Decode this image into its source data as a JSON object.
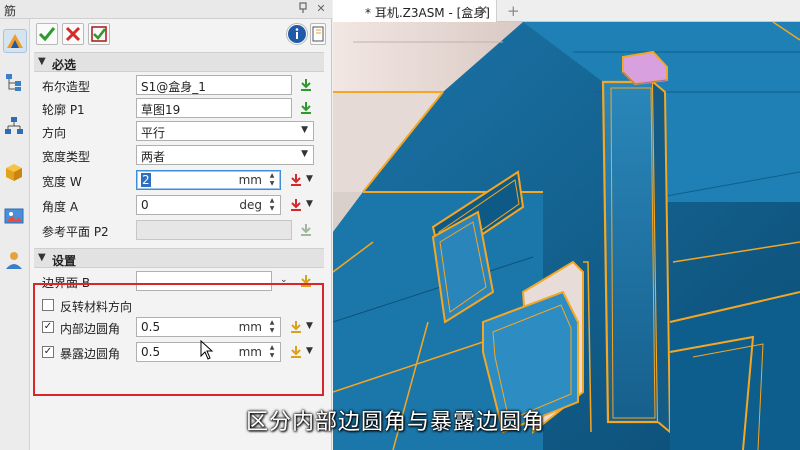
{
  "panel": {
    "title": "筋"
  },
  "sections": {
    "required": "必选",
    "settings": "设置"
  },
  "fields": {
    "boolean_base": {
      "label": "布尔造型",
      "value": "S1@盒身_1"
    },
    "profile": {
      "label": "轮廓 P1",
      "value": "草图19"
    },
    "direction": {
      "label": "方向",
      "value": "平行"
    },
    "width_type": {
      "label": "宽度类型",
      "value": "两者"
    },
    "width": {
      "label": "宽度 W",
      "value": "2",
      "unit": "mm"
    },
    "angle": {
      "label": "角度 A",
      "value": "0",
      "unit": "deg"
    },
    "ref_plane": {
      "label": "参考平面 P2",
      "value": ""
    },
    "boundary": {
      "label": "边界面 B",
      "value": ""
    },
    "reverse_material": {
      "label": "反转材料方向",
      "checked": false
    },
    "inner_fillet": {
      "label": "内部边圆角",
      "checked": true,
      "value": "0.5",
      "unit": "mm"
    },
    "exposed_fillet": {
      "label": "暴露边圆角",
      "checked": true,
      "value": "0.5",
      "unit": "mm"
    }
  },
  "viewport": {
    "tab_title": "* 耳机.Z3ASM - [盒身]",
    "tab_close": "✕",
    "new_tab": "+"
  },
  "subtitle": "区分内部边圆角与暴露边圆角",
  "colors": {
    "accent_blue": "#3c8ed8",
    "highlight_red": "#d9262b",
    "model_blue": "#0f5f8a",
    "edge_orange": "#f5a623"
  }
}
